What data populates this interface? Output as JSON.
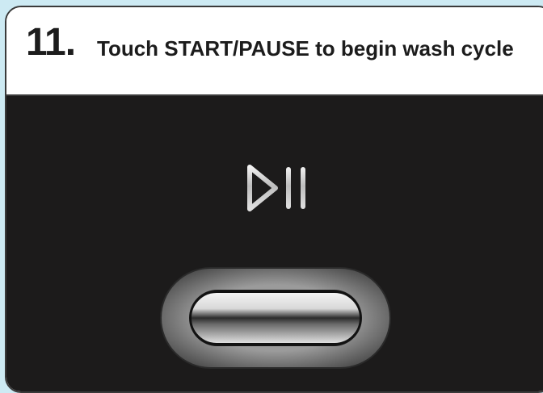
{
  "instruction": {
    "step_number": "11.",
    "text": "Touch START/PAUSE to begin wash cycle"
  },
  "icons": {
    "start_pause": "play-pause-icon"
  },
  "colors": {
    "background": "#cdeaf3",
    "panel": "#1c1b1b",
    "header": "#ffffff",
    "text": "#1c1c1c"
  }
}
